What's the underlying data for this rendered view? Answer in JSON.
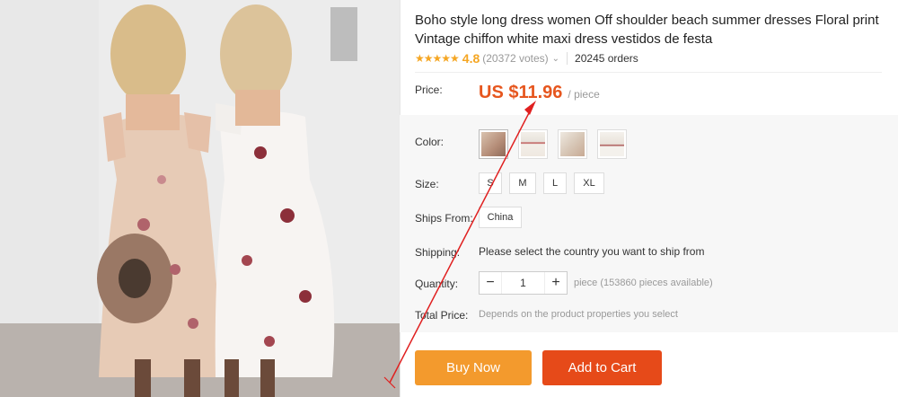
{
  "product": {
    "title": "Boho style long dress women Off shoulder beach summer dresses Floral print Vintage chiffon white maxi dress vestidos de festa",
    "rating": {
      "stars": "★★★★★",
      "score": "4.8",
      "votes": "(20372 votes)",
      "chevron": "⌄",
      "orders": "20245 orders"
    }
  },
  "price": {
    "label": "Price:",
    "value": "US $11.96",
    "unit": "/ piece"
  },
  "color": {
    "label": "Color:",
    "swatches": [
      "swatch-1",
      "swatch-2",
      "swatch-3",
      "swatch-4"
    ]
  },
  "size": {
    "label": "Size:",
    "options": [
      "S",
      "M",
      "L",
      "XL"
    ]
  },
  "ships_from": {
    "label": "Ships From:",
    "value": "China"
  },
  "shipping": {
    "label": "Shipping:",
    "text": "Please select the country you want to ship from"
  },
  "quantity": {
    "label": "Quantity:",
    "minus": "−",
    "value": "1",
    "plus": "+",
    "info": "piece (153860 pieces available)"
  },
  "total": {
    "label": "Total Price:",
    "text": "Depends on the product properties you select"
  },
  "buttons": {
    "buy_now": "Buy Now",
    "add_to_cart": "Add to Cart"
  },
  "colors": {
    "price": "#e6561e",
    "buy_now": "#f39a2d",
    "add_to_cart": "#e64a19",
    "annotation_arrow": "#e02020"
  }
}
